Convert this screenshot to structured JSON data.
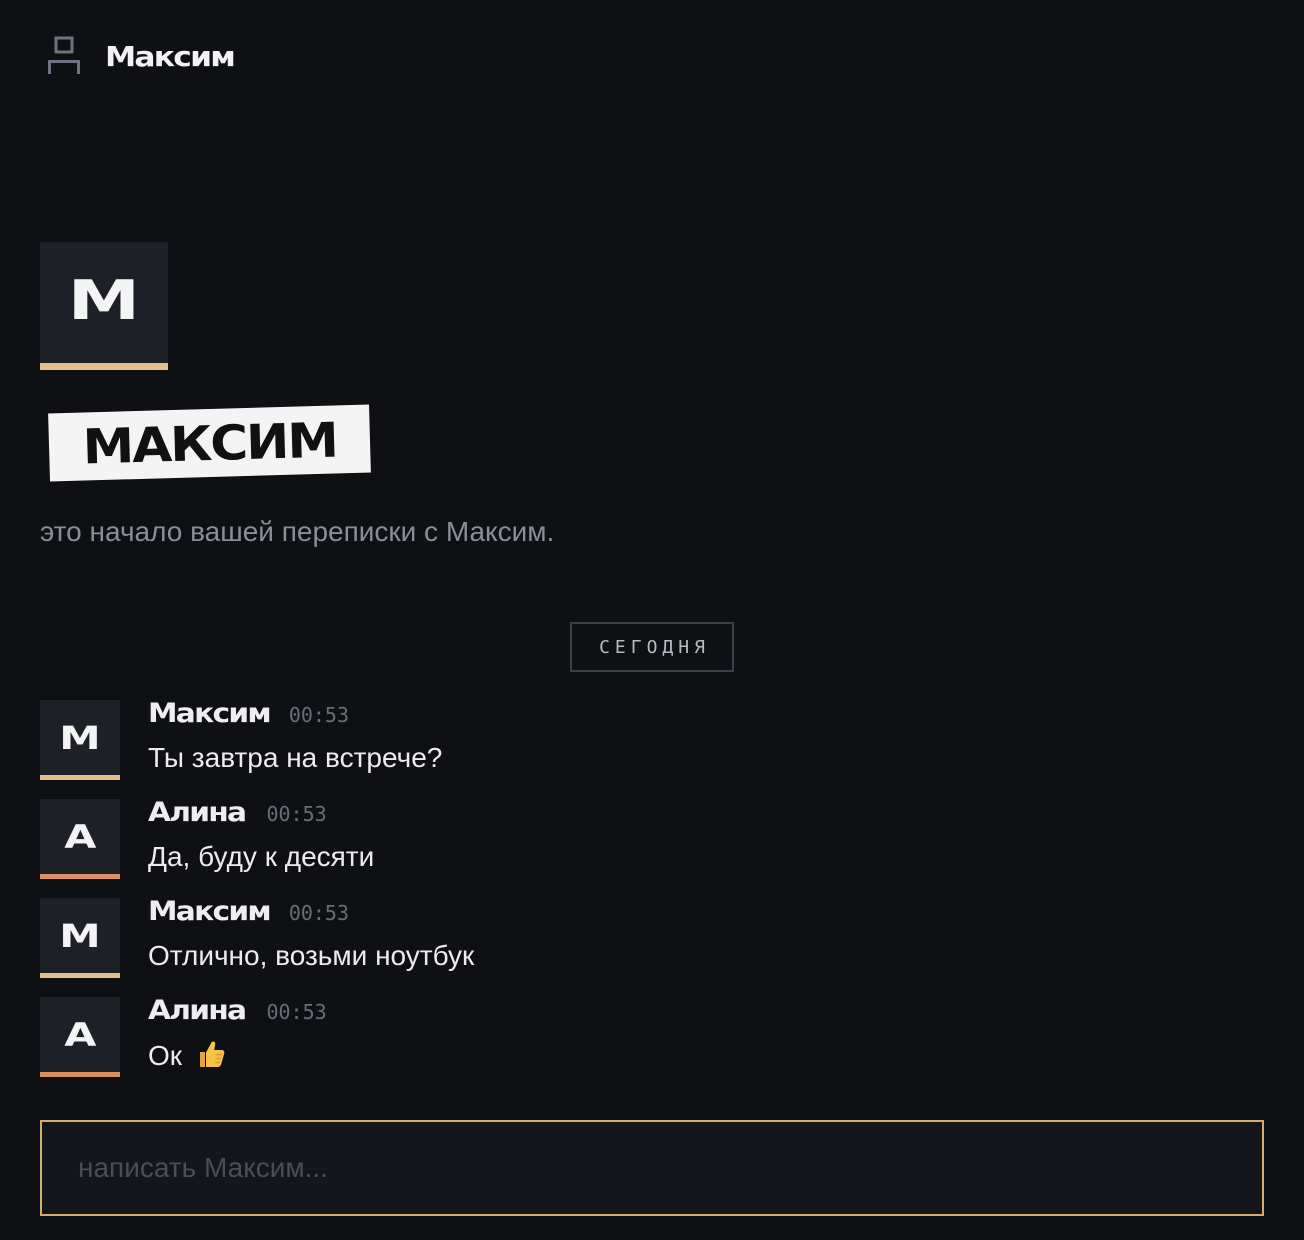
{
  "header": {
    "icon": "user-icon",
    "title": "Максим"
  },
  "profile": {
    "avatar_letter": "М",
    "avatar_accent": "#e3c08a",
    "name_banner": "МАКСИМ",
    "intro": "это начало вашей переписки с Максим."
  },
  "divider": {
    "label": "СЕГОДНЯ"
  },
  "messages": [
    {
      "author": "Максим",
      "initial": "М",
      "time": "00:53",
      "text": "Ты завтра на встрече?",
      "accent": "#e3c08a"
    },
    {
      "author": "Алина",
      "initial": "А",
      "time": "00:53",
      "text": "Да, буду к десяти",
      "accent": "#d98f62"
    },
    {
      "author": "Максим",
      "initial": "М",
      "time": "00:53",
      "text": "Отлично, возьми ноутбук",
      "accent": "#e3c08a"
    },
    {
      "author": "Алина",
      "initial": "А",
      "time": "00:53",
      "text": "Ок",
      "emoji": "thumbs-up-icon",
      "accent": "#d98f62"
    }
  ],
  "composer": {
    "placeholder": "написать Максим...",
    "value": "",
    "border_color": "#d2ad6e"
  },
  "colors": {
    "background": "#0f1014",
    "avatar_bg": "#1e2027",
    "muted_text": "#8a8d9a"
  }
}
